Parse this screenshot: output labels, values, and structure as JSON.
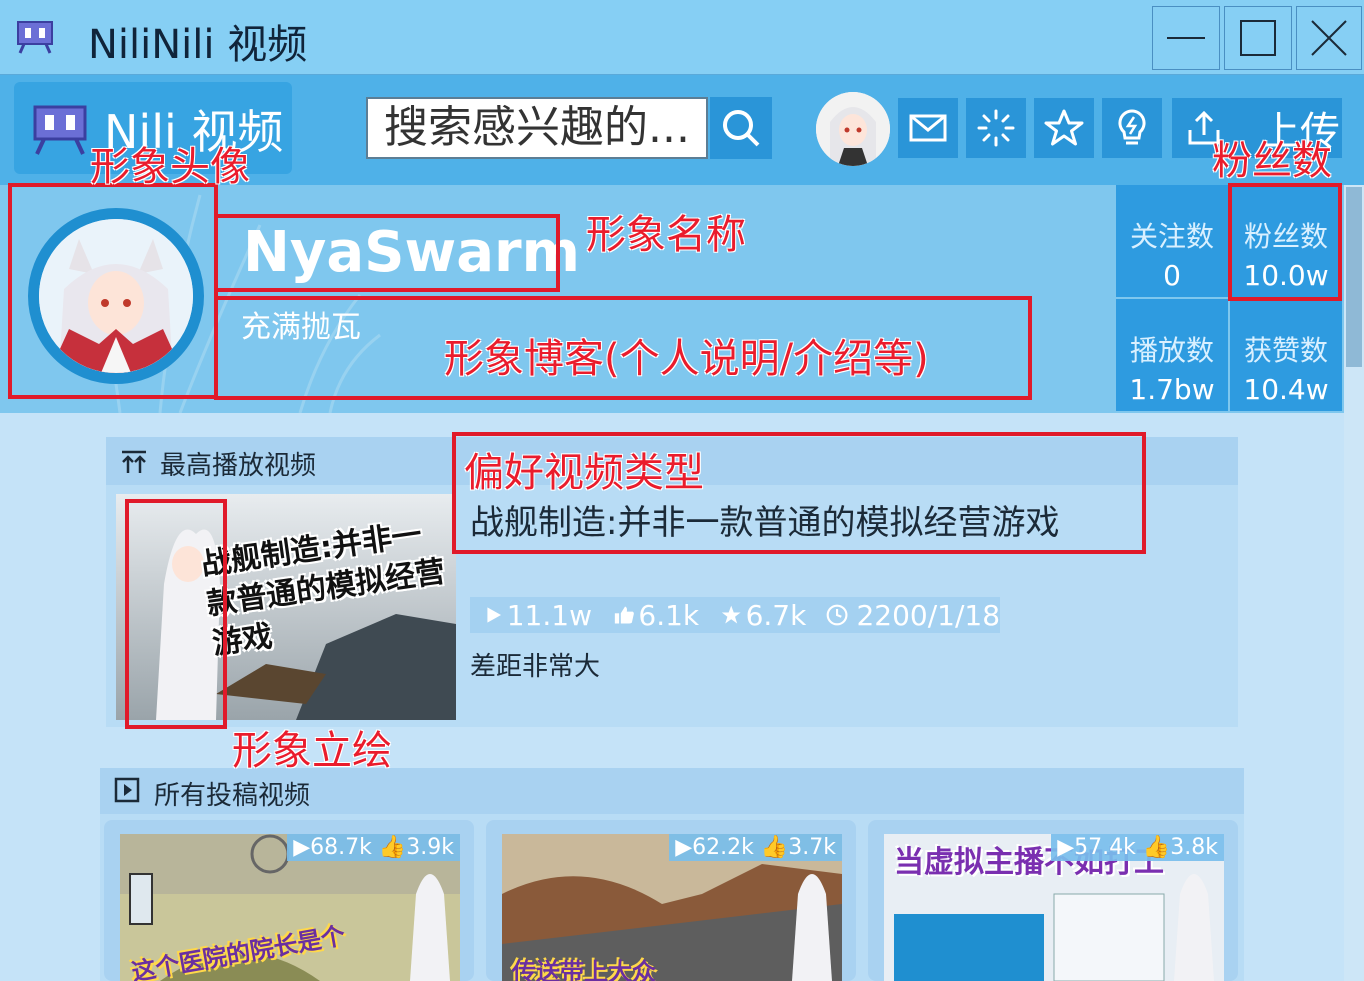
{
  "window": {
    "title": "NiliNili 视频"
  },
  "toolbar": {
    "logo_text": "Nili 视频",
    "search_placeholder": "搜索感兴趣的...",
    "upload_label": "上传",
    "icons": [
      "search-icon",
      "avatar",
      "mail-icon",
      "loading-icon",
      "star-icon",
      "bulb-icon",
      "upload-icon"
    ]
  },
  "profile": {
    "name": "NyaSwarm",
    "blog": "充满抛瓦",
    "stats": [
      {
        "label": "关注数",
        "value": "0"
      },
      {
        "label": "粉丝数",
        "value": "10.0w"
      },
      {
        "label": "播放数",
        "value": "1.7bw"
      },
      {
        "label": "获赞数",
        "value": "10.4w"
      }
    ]
  },
  "top_video": {
    "section_title": "最高播放视频",
    "thumb_text": "战舰制造:并非一款普通的模拟经营游戏",
    "title": "战舰制造:并非一款普通的模拟经营游戏",
    "plays": "11.1w",
    "likes": "6.1k",
    "favs": "6.7k",
    "date": "2200/1/18",
    "description": "差距非常大"
  },
  "all_videos": {
    "section_title": "所有投稿视频",
    "items": [
      {
        "plays": "68.7k",
        "likes": "3.9k",
        "thumb_text": "这个医院的院长是个"
      },
      {
        "plays": "62.2k",
        "likes": "3.7k",
        "thumb_text": "传送带上大众"
      },
      {
        "plays": "57.4k",
        "likes": "3.8k",
        "thumb_text": "当虚拟主播不如打工"
      }
    ]
  },
  "annotations": {
    "avatar": "形象头像",
    "name": "形象名称",
    "blog": "形象博客(个人说明/介绍等)",
    "fans": "粉丝数",
    "video_type": "偏好视频类型",
    "portrait": "形象立绘"
  },
  "colors": {
    "titlebar": "#86cff4",
    "toolbar": "#4fb1e8",
    "accent": "#2a95d8",
    "annotation": "#e01a2a"
  }
}
